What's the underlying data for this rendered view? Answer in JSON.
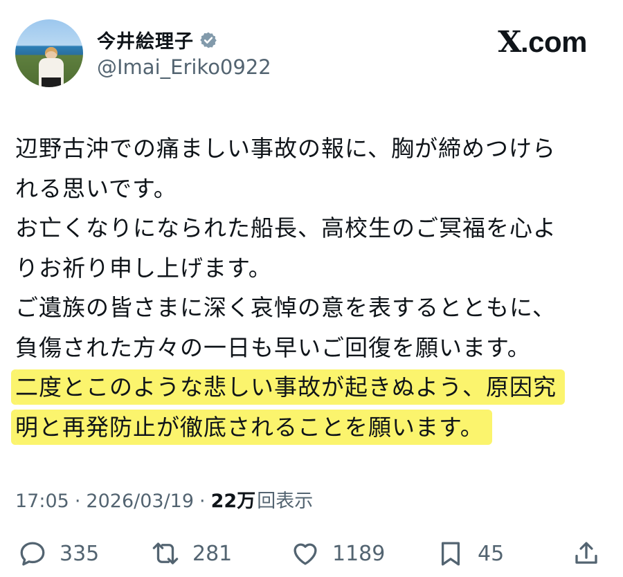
{
  "header": {
    "display_name": "今井絵理子",
    "handle": "@Imai_Eriko0922",
    "brand": ".com",
    "brand_x": "X"
  },
  "tweet": {
    "lines": [
      "辺野古沖での痛ましい事故の報に、胸が締めつけら",
      "れる思いです。",
      "お亡くなりになられた船長、高校生のご冥福を心よ",
      "りお祈り申し上げます。",
      "ご遺族の皆さまに深く哀悼の意を表するとともに、",
      "負傷された方々の一日も早いご回復を願います。"
    ],
    "highlighted_lines": [
      "二度とこのような悲しい事故が起きぬよう、原因究",
      "明と再発防止が徹底されることを願います。"
    ],
    "highlight_color": "#fbf46d"
  },
  "meta": {
    "time": "17:05",
    "separator": "·",
    "date": "2026/03/19",
    "views_count": "22万",
    "views_label": "回表示"
  },
  "actions": {
    "replies": "335",
    "retweets": "281",
    "likes": "1189",
    "bookmarks": "45"
  },
  "colors": {
    "text": "#0f1419",
    "secondary": "#536471",
    "verified_badge": "#829aab"
  },
  "icons": [
    "verified-icon",
    "reply-icon",
    "retweet-icon",
    "like-icon",
    "bookmark-icon",
    "share-icon"
  ]
}
